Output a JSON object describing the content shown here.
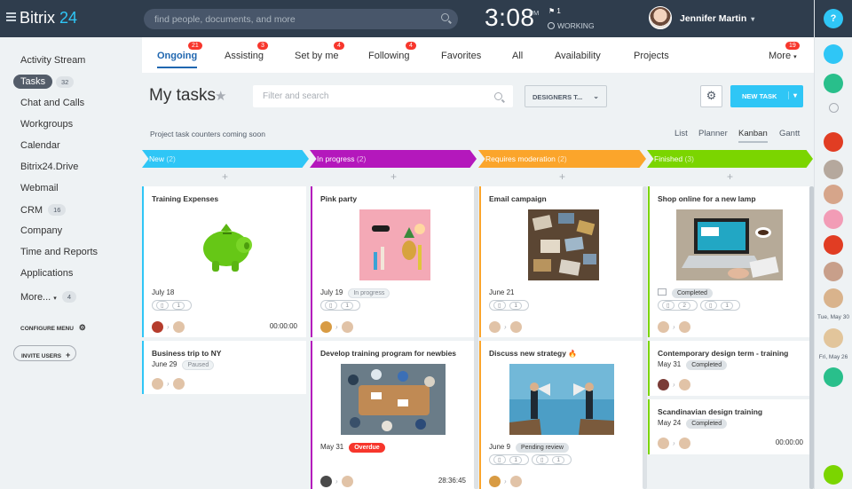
{
  "topbar": {
    "logo_main": "Bitrix",
    "logo_accent": "24",
    "search_placeholder": "find people, documents, and more",
    "time": "3:08",
    "ampm": "PM",
    "flag_count": "1",
    "status": "WORKING",
    "user_name": "Jennifer Martin"
  },
  "sidebar": {
    "items": [
      {
        "label": "Activity Stream",
        "count": ""
      },
      {
        "label": "Tasks",
        "count": "32"
      },
      {
        "label": "Chat and Calls",
        "count": ""
      },
      {
        "label": "Workgroups",
        "count": ""
      },
      {
        "label": "Calendar",
        "count": ""
      },
      {
        "label": "Bitrix24.Drive",
        "count": ""
      },
      {
        "label": "Webmail",
        "count": ""
      },
      {
        "label": "CRM",
        "count": "16"
      },
      {
        "label": "Company",
        "count": ""
      },
      {
        "label": "Time and Reports",
        "count": ""
      },
      {
        "label": "Applications",
        "count": ""
      },
      {
        "label": "More...",
        "count": "4"
      }
    ],
    "configure_menu": "CONFIGURE MENU",
    "invite_users": "INVITE USERS"
  },
  "tabs": [
    {
      "label": "Ongoing",
      "badge": "21"
    },
    {
      "label": "Assisting",
      "badge": "3"
    },
    {
      "label": "Set by me",
      "badge": "4"
    },
    {
      "label": "Following",
      "badge": "4"
    },
    {
      "label": "Favorites",
      "badge": ""
    },
    {
      "label": "All",
      "badge": ""
    },
    {
      "label": "Availability",
      "badge": ""
    },
    {
      "label": "Projects",
      "badge": ""
    },
    {
      "label": "More",
      "badge": "19"
    }
  ],
  "toolbar": {
    "title": "My tasks",
    "filter_placeholder": "Filter and search",
    "preset": "DESIGNERS T...",
    "new_task": "NEW TASK"
  },
  "notice": "Project task counters coming soon",
  "views": [
    "List",
    "Planner",
    "Kanban",
    "Gantt"
  ],
  "active_view": "Kanban",
  "columns": [
    {
      "name": "New",
      "count": "(2)",
      "color": "#2fc6f6"
    },
    {
      "name": "In progress",
      "count": "(2)",
      "color": "#b418bc"
    },
    {
      "name": "Requires moderation",
      "count": "(2)",
      "color": "#fba52b"
    },
    {
      "name": "Finished",
      "count": "(3)",
      "color": "#7bd500"
    }
  ],
  "cards": {
    "c1": {
      "title": "Training Expenses",
      "date": "July 18",
      "chip1": "1",
      "timer": "00:00:00"
    },
    "c2": {
      "title": "Business trip to NY",
      "date": "June 29",
      "tag": "Paused"
    },
    "c3": {
      "title": "Pink party",
      "date": "July 19",
      "tag": "In progress",
      "chip1": "1"
    },
    "c4": {
      "title": "Develop training program for newbies",
      "date": "May 31",
      "tag": "Overdue",
      "timer": "28:36:45"
    },
    "c5": {
      "title": "Email campaign",
      "date": "June 21",
      "chip1": "1"
    },
    "c6": {
      "title": "Discuss new strategy",
      "date": "June 9",
      "tag": "Pending review",
      "chip1": "1",
      "chip2": "1"
    },
    "c7": {
      "title": "Shop online for a new lamp",
      "tag": "Completed",
      "chip1": "2",
      "chip2": "1"
    },
    "c8": {
      "title": "Contemporary design term - training",
      "date": "May 31",
      "tag": "Completed"
    },
    "c9": {
      "title": "Scandinavian design training",
      "date": "May 24",
      "tag": "Completed",
      "timer": "00:00:00"
    }
  },
  "rightbar": {
    "help": "?",
    "date1": "Tue, May 30",
    "date2": "Fri, May 26"
  }
}
